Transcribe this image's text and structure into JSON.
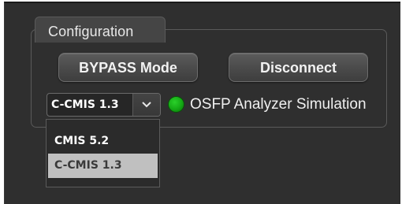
{
  "config": {
    "title": "Configuration",
    "bypass_label": "BYPASS Mode",
    "disconnect_label": "Disconnect",
    "version_selected": "C-CMIS 1.3",
    "version_options": [
      "CMIS 5.2",
      "C-CMIS 1.3"
    ],
    "highlighted_option": "C-CMIS 1.3",
    "status_label": "OSFP Analyzer Simulation",
    "status_color": "#17b317"
  },
  "icons": {
    "dropdown": "chevron-down-icon",
    "status": "status-led-icon"
  }
}
